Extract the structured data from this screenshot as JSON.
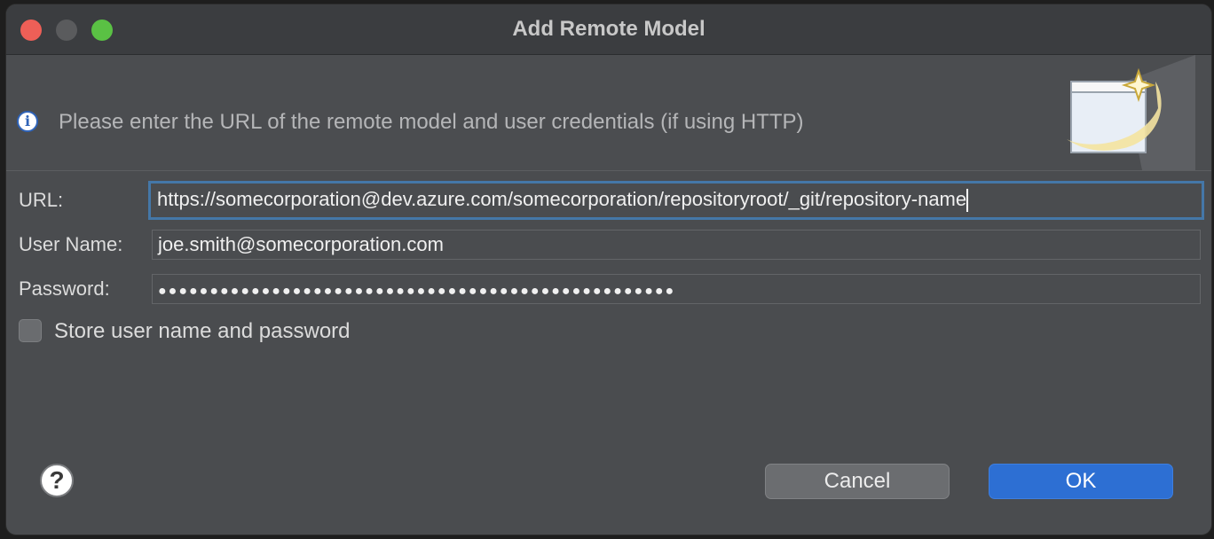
{
  "window": {
    "title": "Add Remote Model"
  },
  "banner": {
    "message": "Please enter the URL of the remote model and user credentials (if using HTTP)",
    "icon": "info-icon"
  },
  "form": {
    "url_label": "URL:",
    "url_value": "https://somecorporation@dev.azure.com/somecorporation/repositoryroot/_git/repository-name",
    "username_label": "User Name:",
    "username_value": "joe.smith@somecorporation.com",
    "password_label": "Password:",
    "password_value": "●●●●●●●●●●●●●●●●●●●●●●●●●●●●●●●●●●●●●●●●●●●●●●●●●●",
    "store_label": "Store user name and password",
    "store_checked": false
  },
  "buttons": {
    "help": "?",
    "cancel": "Cancel",
    "ok": "OK"
  },
  "colors": {
    "accent": "#2d6fd3",
    "focus_ring": "#4477a8",
    "close": "#ee5f57",
    "maximize": "#5ac144"
  }
}
